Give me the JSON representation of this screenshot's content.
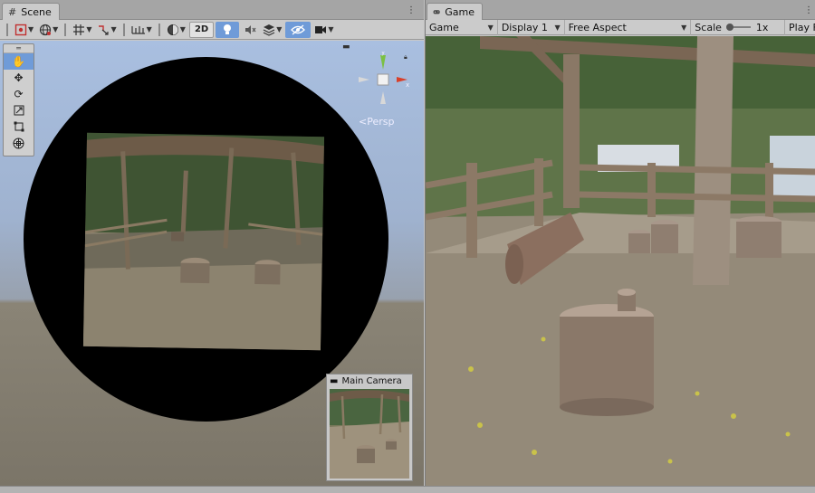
{
  "scene": {
    "tab_label": "Scene",
    "tab_icon": "hash-grid-icon",
    "toolbar": {
      "mode_2d_label": "2D"
    },
    "camera_projection_label": "Persp",
    "gizmo_axes": {
      "x": "x",
      "y": "y"
    },
    "tools": [
      "hand-tool-icon",
      "move-tool-icon",
      "rotate-tool-icon",
      "scale-tool-icon",
      "rect-tool-icon",
      "transform-tool-icon"
    ],
    "camera_preview": {
      "title": "Main Camera"
    }
  },
  "game": {
    "tab_label": "Game",
    "tab_icon": "gamepad-icon",
    "toolbar": {
      "view_select": "Game",
      "display_select": "Display 1",
      "aspect_select": "Free Aspect",
      "scale_label": "Scale",
      "scale_value": "1x",
      "play_label": "Play F"
    }
  },
  "colors": {
    "accent": "#6f9bd8",
    "gizmo_x": "#d8402a",
    "gizmo_y": "#7bc043"
  }
}
